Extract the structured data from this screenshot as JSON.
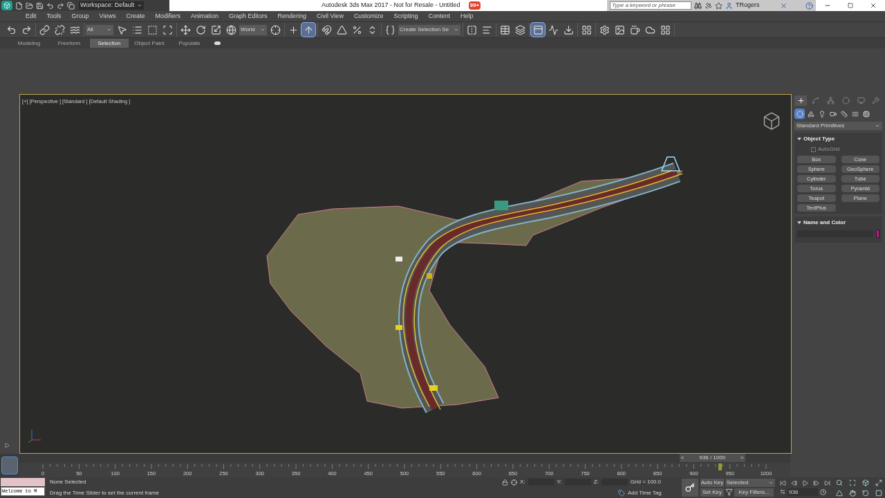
{
  "title_bar": {
    "workspace": "Workspace: Default",
    "title": "Autodesk 3ds Max 2017 - Not for Resale - Untitled",
    "notification_count": "99+",
    "search": {
      "placeholder": "Type a keyword or phrase"
    },
    "user": "TRogers"
  },
  "menu": [
    "Edit",
    "Tools",
    "Group",
    "Views",
    "Create",
    "Modifiers",
    "Animation",
    "Graph Editors",
    "Rendering",
    "Civil View",
    "Customize",
    "Scripting",
    "Content",
    "Help"
  ],
  "toolbar": [
    [
      {
        "kind": "button",
        "selected": false
      },
      {
        "kind": "button",
        "selected": false
      }
    ],
    [
      {
        "kind": "button",
        "selected": false
      },
      {
        "kind": "button",
        "selected": false
      },
      {
        "kind": "button",
        "selected": false
      }
    ],
    [
      {
        "kind": "dropdown",
        "label": "All"
      },
      {
        "kind": "button",
        "selected": false
      },
      {
        "kind": "button",
        "selected": false
      },
      {
        "kind": "button",
        "selected": false
      },
      {
        "kind": "button",
        "selected": false
      }
    ],
    [
      {
        "kind": "button",
        "selected": false
      },
      {
        "kind": "button",
        "selected": false
      },
      {
        "kind": "button",
        "selected": false
      },
      {
        "kind": "button",
        "selected": false
      },
      {
        "kind": "dropdown",
        "label": "World"
      },
      {
        "kind": "button",
        "selected": false
      }
    ],
    [
      {
        "kind": "button",
        "selected": false
      },
      {
        "kind": "button",
        "selected": true
      }
    ],
    [
      {
        "kind": "button",
        "selected": false
      },
      {
        "kind": "button",
        "selected": false
      },
      {
        "kind": "button",
        "selected": false
      },
      {
        "kind": "button",
        "selected": false
      }
    ],
    [
      {
        "kind": "button",
        "selected": false
      },
      {
        "kind": "dropdown",
        "label": "Create Selection Se"
      }
    ],
    [
      {
        "kind": "button",
        "selected": false
      },
      {
        "kind": "button",
        "selected": false
      }
    ],
    [
      {
        "kind": "button",
        "selected": false
      },
      {
        "kind": "button",
        "selected": false
      }
    ],
    [
      {
        "kind": "button",
        "selected": true
      },
      {
        "kind": "button",
        "selected": false
      },
      {
        "kind": "button",
        "selected": false
      }
    ],
    [
      {
        "kind": "button",
        "selected": false
      }
    ],
    [
      {
        "kind": "button",
        "selected": false
      },
      {
        "kind": "button",
        "selected": false
      },
      {
        "kind": "button",
        "selected": false
      },
      {
        "kind": "button",
        "selected": false
      },
      {
        "kind": "button",
        "selected": false
      }
    ]
  ],
  "ribbon_tabs": [
    {
      "label": "Modeling",
      "selected": false
    },
    {
      "label": "Freeform",
      "selected": false
    },
    {
      "label": "Selection",
      "selected": true
    },
    {
      "label": "Object Paint",
      "selected": false
    },
    {
      "label": "Populate",
      "selected": false
    }
  ],
  "viewport": {
    "labels": [
      "[+]",
      "[Perspective ]",
      "[Standard ]",
      "[Default Shading ]"
    ]
  },
  "command_panel": {
    "tabs": [
      {
        "selected": true
      },
      {
        "selected": false
      },
      {
        "selected": false
      },
      {
        "selected": false
      },
      {
        "selected": false
      },
      {
        "selected": false
      }
    ],
    "categories": [
      {
        "selected": true
      },
      {
        "selected": false
      },
      {
        "selected": false
      },
      {
        "selected": false
      },
      {
        "selected": false
      },
      {
        "selected": false
      },
      {
        "selected": false
      }
    ],
    "dropdown": "Standard Primitives",
    "object_type": {
      "title": "Object Type",
      "expanded": true,
      "autogrid": {
        "label": "AutoGrid",
        "checked": false,
        "disabled": true
      },
      "buttons": [
        "Box",
        "Cone",
        "Sphere",
        "GeoSphere",
        "Cylinder",
        "Tube",
        "Torus",
        "Pyramid",
        "Teapot",
        "Plane",
        "TextPlus"
      ]
    },
    "name_color": {
      "title": "Name and Color",
      "expanded": true,
      "color": "#c0148c"
    }
  },
  "time_slider": {
    "label": "936 / 1000",
    "prev": "<",
    "next": ">",
    "level": 0.936
  },
  "ruler": {
    "labels": [
      "0",
      "50",
      "100",
      "150",
      "200",
      "250",
      "300",
      "350",
      "400",
      "450",
      "500",
      "550",
      "600",
      "650",
      "700",
      "750",
      "800",
      "850",
      "900",
      "950",
      "1000"
    ]
  },
  "status": {
    "listener": "Welcome to M",
    "selection": "None Selected",
    "prompt": "Drag the Time Slider to set the current frame",
    "x_label": "X:",
    "y_label": "Y:",
    "z_label": "Z:",
    "grid": "Grid = 100.0",
    "time_tag": "Add Time Tag",
    "auto_key": "Auto Key",
    "key_mode": "Selected",
    "set_key": "Set Key",
    "key_filters": "Key Filters...",
    "frame": "936"
  }
}
